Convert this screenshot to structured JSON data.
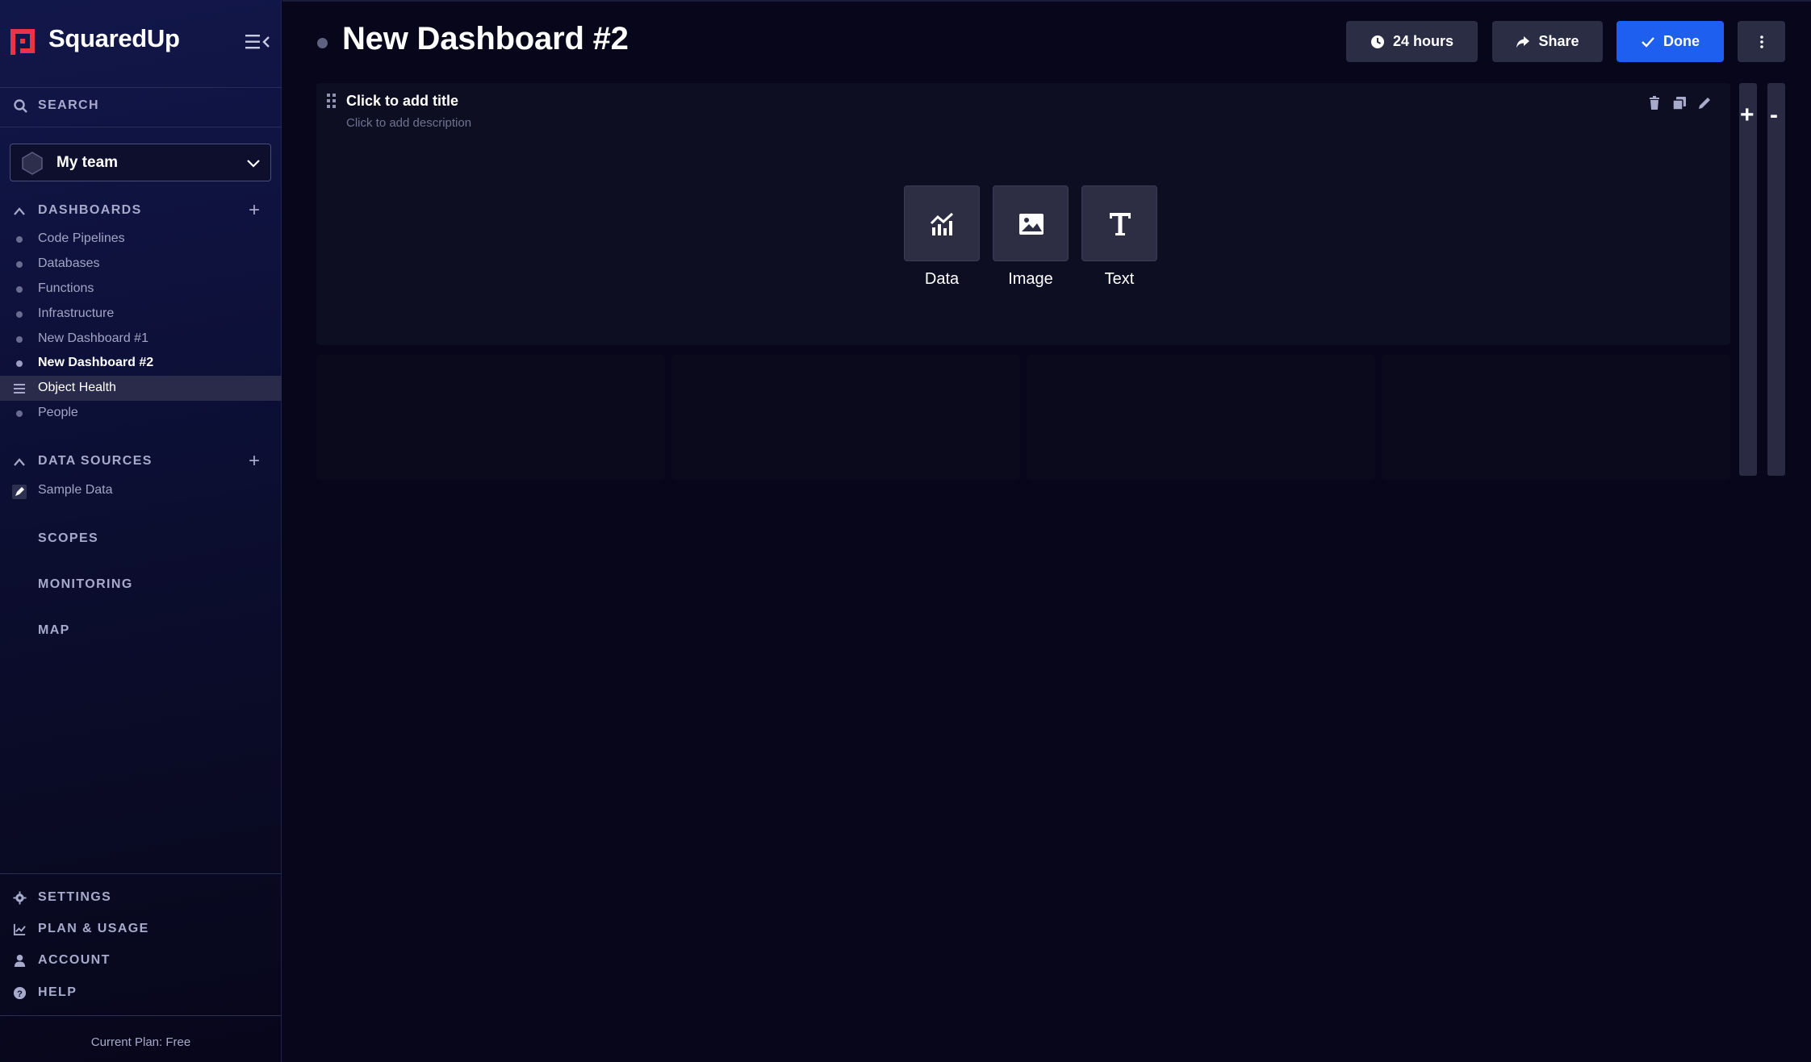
{
  "brand": {
    "name": "SquaredUp",
    "accent": "#e8334a"
  },
  "sidebar": {
    "search_label": "SEARCH",
    "team": {
      "name": "My team"
    },
    "dashboards": {
      "label": "DASHBOARDS",
      "items": [
        {
          "label": "Code Pipelines",
          "state": "normal"
        },
        {
          "label": "Databases",
          "state": "normal"
        },
        {
          "label": "Functions",
          "state": "normal"
        },
        {
          "label": "Infrastructure",
          "state": "normal"
        },
        {
          "label": "New Dashboard #1",
          "state": "normal"
        },
        {
          "label": "New Dashboard #2",
          "state": "active"
        },
        {
          "label": "Object Health",
          "state": "hovered"
        },
        {
          "label": "People",
          "state": "normal"
        }
      ]
    },
    "data_sources": {
      "label": "DATA SOURCES",
      "items": [
        {
          "label": "Sample Data"
        }
      ]
    },
    "scopes_label": "SCOPES",
    "monitoring_label": "MONITORING",
    "map_label": "MAP",
    "bottom": {
      "settings": "SETTINGS",
      "plan_usage": "PLAN & USAGE",
      "account": "ACCOUNT",
      "help": "HELP"
    },
    "plan_text": "Current Plan: Free"
  },
  "header": {
    "title": "New Dashboard #2",
    "timeframe": "24 hours",
    "share": "Share",
    "done": "Done",
    "done_color": "#1f5ff0"
  },
  "tile": {
    "title": "Click to add title",
    "description": "Click to add description",
    "types": [
      {
        "label": "Data",
        "icon": "chart-icon"
      },
      {
        "label": "Image",
        "icon": "image-icon"
      },
      {
        "label": "Text",
        "icon": "text-icon"
      }
    ]
  }
}
